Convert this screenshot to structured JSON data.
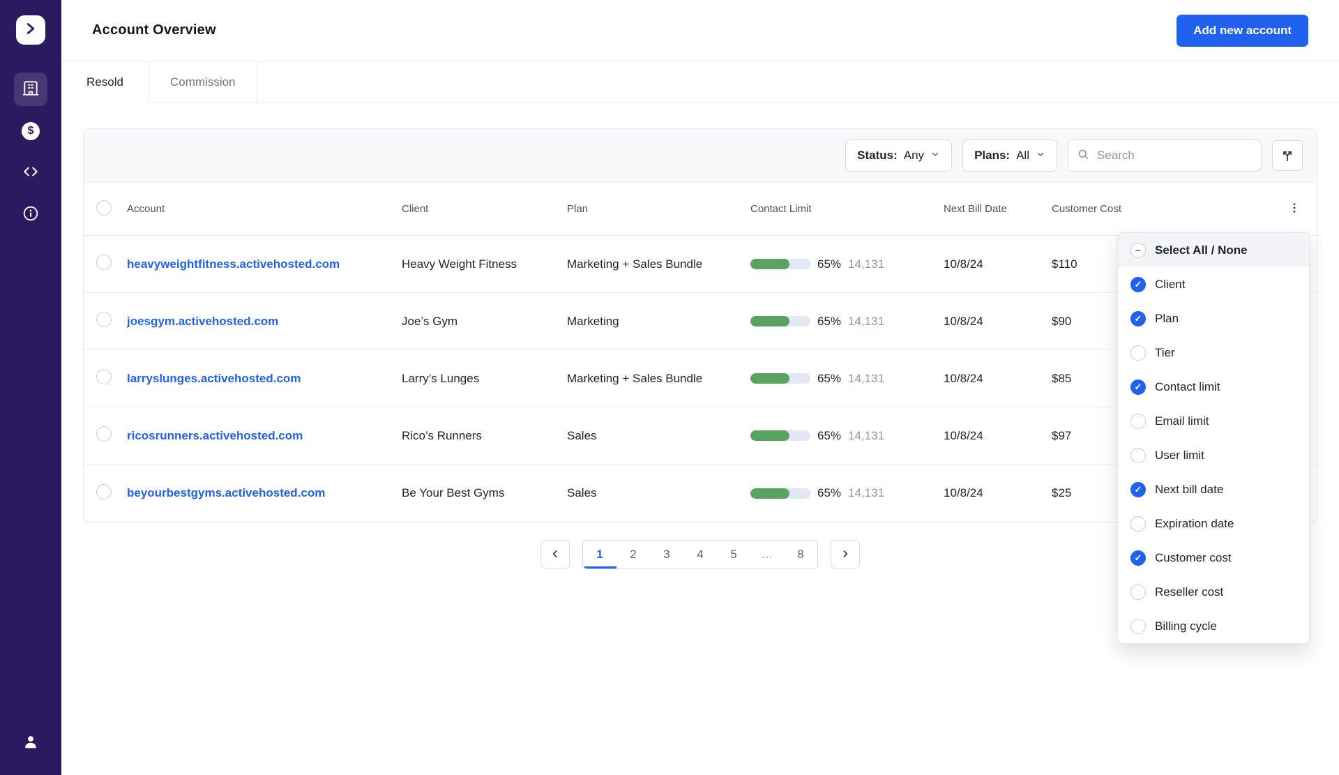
{
  "colors": {
    "accent_blue": "#2161F0",
    "sidebar_purple": "#2A1A5F",
    "progress_green": "#5AA35F",
    "link_blue": "#2161F0"
  },
  "icons": {
    "dollar": "$"
  },
  "header": {
    "title": "Account Overview",
    "add_button_label": "Add new account"
  },
  "tabs": [
    {
      "label": "Resold",
      "active": true
    },
    {
      "label": "Commission",
      "active": false
    }
  ],
  "toolbar": {
    "status_label": "Status:",
    "status_value": "Any",
    "plans_label": "Plans:",
    "plans_value": "All",
    "search_placeholder": "Search"
  },
  "table": {
    "columns": [
      "Account",
      "Client",
      "Plan",
      "Contact Limit",
      "Next Bill Date",
      "Customer Cost"
    ],
    "contact_fill_percent": 65,
    "rows": [
      {
        "account": "heavyweightfitness.activehosted.com",
        "client": "Heavy Weight Fitness",
        "plan": "Marketing + Sales Bundle",
        "contact_pct": "65%",
        "contact_count": "14,131",
        "next_bill_date": "10/8/24",
        "customer_cost": "$110"
      },
      {
        "account": "joesgym.activehosted.com",
        "client": "Joe’s Gym",
        "plan": "Marketing",
        "contact_pct": "65%",
        "contact_count": "14,131",
        "next_bill_date": "10/8/24",
        "customer_cost": "$90"
      },
      {
        "account": "larryslunges.activehosted.com",
        "client": "Larry’s Lunges",
        "plan": "Marketing + Sales Bundle",
        "contact_pct": "65%",
        "contact_count": "14,131",
        "next_bill_date": "10/8/24",
        "customer_cost": "$85"
      },
      {
        "account": "ricosrunners.activehosted.com",
        "client": "Rico’s Runners",
        "plan": "Sales",
        "contact_pct": "65%",
        "contact_count": "14,131",
        "next_bill_date": "10/8/24",
        "customer_cost": "$97"
      },
      {
        "account": "beyourbestgyms.activehosted.com",
        "client": "Be Your Best Gyms",
        "plan": "Sales",
        "contact_pct": "65%",
        "contact_count": "14,131",
        "next_bill_date": "10/8/24",
        "customer_cost": "$25"
      }
    ]
  },
  "pagination": {
    "pages": [
      "1",
      "2",
      "3",
      "4",
      "5",
      "…",
      "8"
    ],
    "active_page": "1"
  },
  "column_menu": {
    "select_all_label": "Select All / None",
    "items": [
      {
        "label": "Client",
        "checked": true
      },
      {
        "label": "Plan",
        "checked": true
      },
      {
        "label": "Tier",
        "checked": false
      },
      {
        "label": "Contact limit",
        "checked": true
      },
      {
        "label": "Email limit",
        "checked": false
      },
      {
        "label": "User limit",
        "checked": false
      },
      {
        "label": "Next bill date",
        "checked": true
      },
      {
        "label": "Expiration date",
        "checked": false
      },
      {
        "label": "Customer cost",
        "checked": true
      },
      {
        "label": "Reseller cost",
        "checked": false
      },
      {
        "label": "Billing cycle",
        "checked": false
      }
    ]
  }
}
